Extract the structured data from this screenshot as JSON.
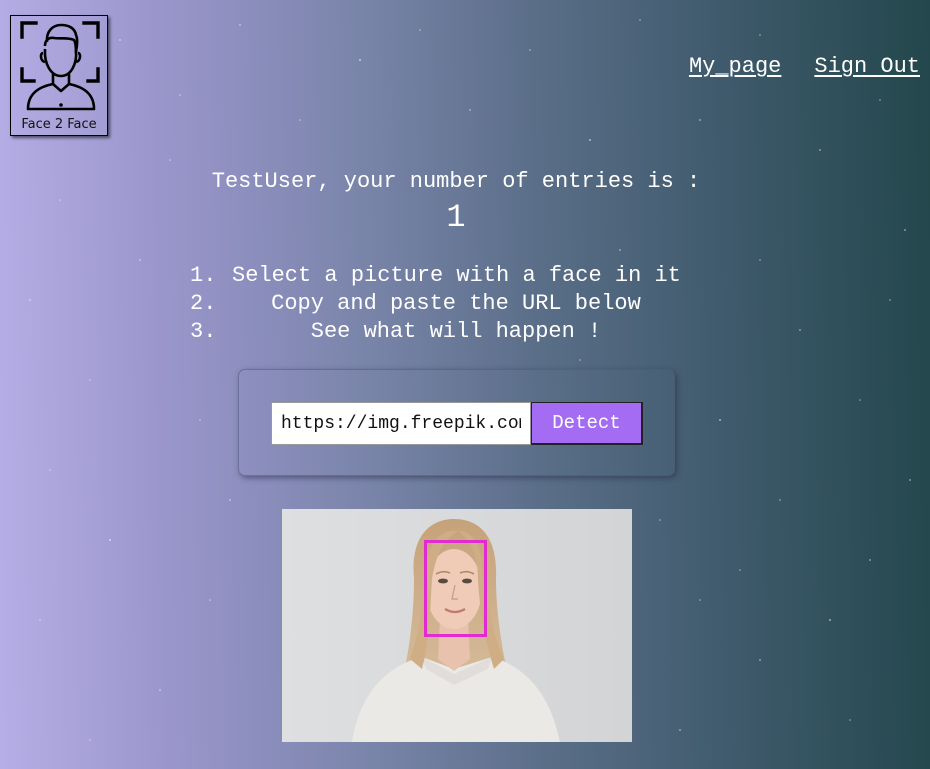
{
  "logo": {
    "text": "Face 2 Face",
    "icon": "face-scan-icon"
  },
  "nav": {
    "my_page": "My_page",
    "sign_out": "Sign Out"
  },
  "main": {
    "greeting": "TestUser, your number of entries is :",
    "entries_count": "1",
    "steps": [
      {
        "number": "1.",
        "text": "Select a picture with a face in it"
      },
      {
        "number": "2.",
        "text": "Copy and paste the URL below"
      },
      {
        "number": "3.",
        "text": "See what will happen !"
      }
    ]
  },
  "form": {
    "url_value": "https://img.freepik.com/free-photo/",
    "detect_label": "Detect"
  },
  "result": {
    "image_icon": "portrait-photo",
    "face_box_color": "#e22ad0"
  },
  "colors": {
    "button": "#a36cf3",
    "gradient_start": "#b6aee6",
    "gradient_end": "#23474c"
  }
}
